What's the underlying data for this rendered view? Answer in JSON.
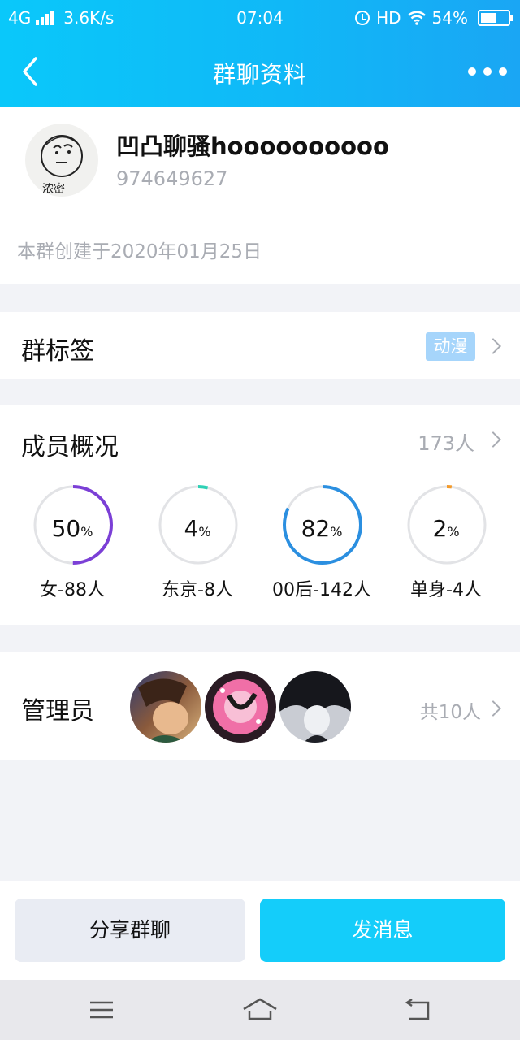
{
  "status_bar": {
    "network": "4G",
    "speed": "3.6K/s",
    "time": "07:04",
    "hd": "HD",
    "battery": "54%"
  },
  "header": {
    "title": "群聊资料"
  },
  "profile": {
    "group_name": "凹凸聊骚hoooooooooo",
    "group_id": "974649627",
    "avatar_caption": "浓密",
    "created": "本群创建于2020年01月25日"
  },
  "tags_row": {
    "title": "群标签",
    "tag": "动漫"
  },
  "members_row": {
    "title": "成员概况",
    "count": "173人",
    "stats": [
      {
        "value": "50",
        "unit": "%",
        "label": "女-88人",
        "fraction": 0.5,
        "color": "#7b3fd6"
      },
      {
        "value": "4",
        "unit": "%",
        "label": "东京-8人",
        "fraction": 0.04,
        "color": "#2ed1b5"
      },
      {
        "value": "82",
        "unit": "%",
        "label": "00后-142人",
        "fraction": 0.82,
        "color": "#2b8fe0"
      },
      {
        "value": "2",
        "unit": "%",
        "label": "单身-4人",
        "fraction": 0.02,
        "color": "#f39a2b"
      }
    ]
  },
  "admins_row": {
    "title": "管理员",
    "count": "共10人"
  },
  "actions": {
    "share": "分享群聊",
    "send": "发消息"
  },
  "colors": {
    "header_start": "#0ac8fa",
    "header_end": "#1aa6f4",
    "send_button": "#14cdfa",
    "tag_chip": "#a6d5fb"
  }
}
